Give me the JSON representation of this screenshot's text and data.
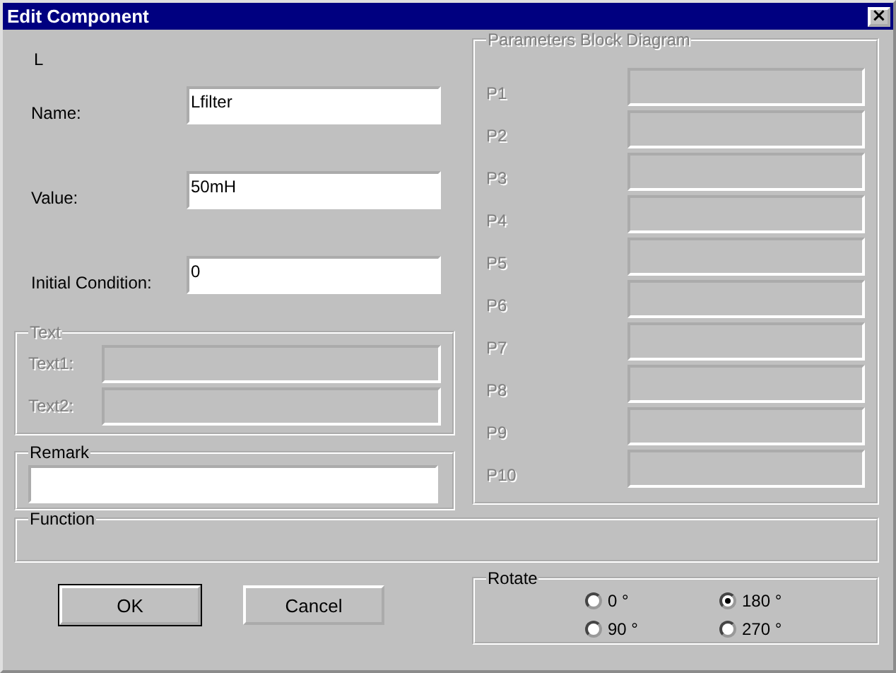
{
  "window": {
    "title": "Edit Component",
    "close": "×"
  },
  "component_type": "L",
  "fields": [
    {
      "label": "Name:",
      "value": "Lfilter"
    },
    {
      "label": "Value:",
      "value": "50mH"
    },
    {
      "label": "Initial Condition:",
      "value": "0"
    }
  ],
  "text_group": {
    "title": "Text",
    "disabled": true,
    "fields": [
      {
        "label": "Text1:"
      },
      {
        "label": "Text2:"
      }
    ]
  },
  "remark_group": {
    "title": "Remark"
  },
  "parameters_group": {
    "title": "Parameters Block Diagram",
    "disabled": true,
    "fields": [
      {
        "label": "P1"
      },
      {
        "label": "P2"
      },
      {
        "label": "P3"
      },
      {
        "label": "P4"
      },
      {
        "label": "P5"
      },
      {
        "label": "P6"
      },
      {
        "label": "P7"
      },
      {
        "label": "P8"
      },
      {
        "label": "P9"
      },
      {
        "label": "P10"
      }
    ]
  },
  "function_group": {
    "title": "Function"
  },
  "buttons": [
    {
      "label": "OK",
      "default": true
    },
    {
      "label": "Cancel",
      "default": false
    }
  ],
  "rotate": {
    "title": "Rotate",
    "options": [
      {
        "label": "0 °",
        "selected": false
      },
      {
        "label": "180 °",
        "selected": true
      },
      {
        "label": "90 °",
        "selected": false
      },
      {
        "label": "270 °",
        "selected": false
      }
    ]
  }
}
